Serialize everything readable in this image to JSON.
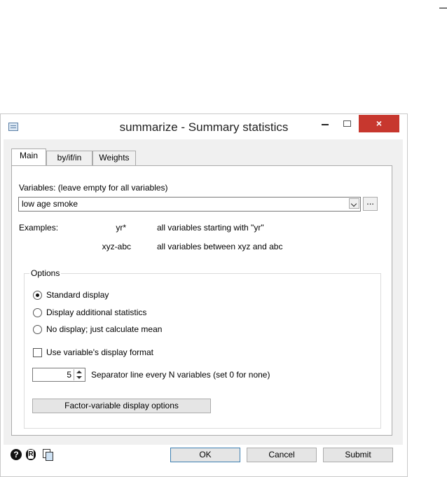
{
  "window": {
    "title": "summarize - Summary statistics",
    "close_glyph": "×"
  },
  "tabs": [
    {
      "label": "Main",
      "active": true
    },
    {
      "label": "by/if/in",
      "active": false
    },
    {
      "label": "Weights",
      "active": false
    }
  ],
  "variables": {
    "label": "Variables: (leave empty for all variables)",
    "value": "low age smoke",
    "browse_label": "..."
  },
  "examples": {
    "label": "Examples:",
    "rows": [
      {
        "pattern": "yr*",
        "description": "all variables starting with \"yr\""
      },
      {
        "pattern": "xyz-abc",
        "description": "all variables between xyz and abc"
      }
    ]
  },
  "options": {
    "legend": "Options",
    "radios": [
      {
        "label": "Standard display",
        "checked": true
      },
      {
        "label": "Display additional statistics",
        "checked": false
      },
      {
        "label": "No display; just calculate mean",
        "checked": false
      }
    ],
    "format_checkbox": {
      "label": "Use variable's display format",
      "checked": false
    },
    "separator": {
      "value": "5",
      "label": "Separator line every N variables (set 0 for none)"
    },
    "factor_button": "Factor-variable display options"
  },
  "footer": {
    "help_glyph": "?",
    "ok": "OK",
    "cancel": "Cancel",
    "submit": "Submit"
  },
  "colors": {
    "close_button": "#c7372e",
    "default_button_border": "#3c7fb1"
  }
}
